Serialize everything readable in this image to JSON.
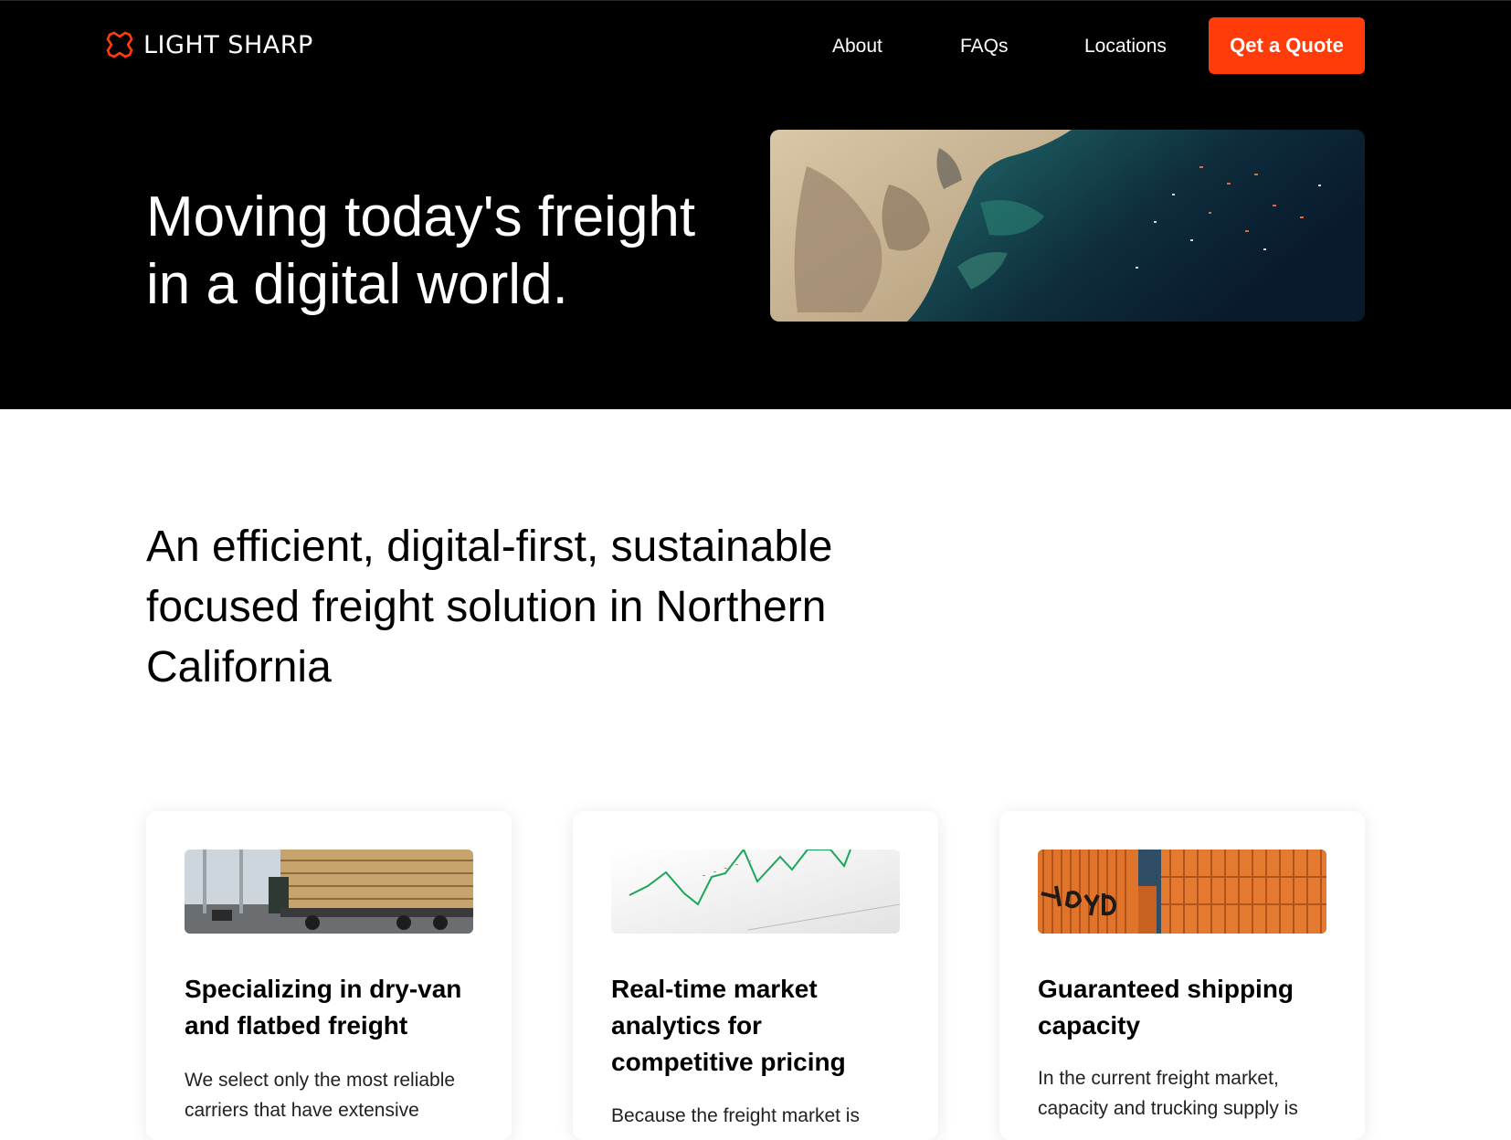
{
  "header": {
    "brand": "LIGHT SHARP",
    "logo_icon": "light-sharp-star-logo",
    "nav": [
      "About",
      "FAQs",
      "Locations"
    ],
    "cta_label": "Qet a Quote"
  },
  "hero": {
    "title": "Moving today's freight in a digital world.",
    "image_desc": "aerial-port-satellite-image"
  },
  "intro": {
    "heading": "An efficient, digital-first, sustainable focused freight solution in Northern California"
  },
  "features": [
    {
      "title": "Specializing in dry-van and flatbed freight",
      "text": "We select only the most reliable carriers that have extensive",
      "image": "flatbed-lumber-truck-photo"
    },
    {
      "title": "Real-time market analytics for competitive pricing",
      "text": "Because the freight market is",
      "image": "market-chart-photo"
    },
    {
      "title": "Guaranteed shipping capacity",
      "text": "In the current freight market, capacity and trucking supply is",
      "image": "orange-shipping-containers-photo"
    }
  ],
  "colors": {
    "accent": "#ff3c0a",
    "hero_bg": "#000000",
    "page_bg": "#ffffff"
  }
}
